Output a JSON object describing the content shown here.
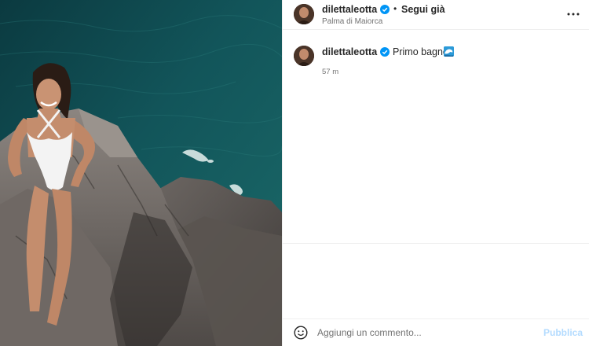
{
  "post": {
    "author": {
      "username": "dilettaleotta",
      "verified": true,
      "follow_status": "Segui già",
      "location": "Palma di Maiorca"
    },
    "caption": {
      "username": "dilettaleotta",
      "text": "Primo bagno",
      "emoji_icon": "water-wave-icon",
      "time_ago": "57 m"
    },
    "comment_box": {
      "placeholder": "Aggiungi un commento...",
      "value": "",
      "publish_label": "Pubblica"
    }
  },
  "icons": {
    "more": "more-options-icon",
    "verified": "verified-badge-icon",
    "emoji": "emoji-icon"
  },
  "colors": {
    "verified_blue": "#0095f6",
    "publish_disabled": "#b3dbff",
    "secondary_text": "#737373",
    "primary_text": "#262626",
    "sea_dark": "#0b3b40",
    "sea_teal": "#1d6a6c"
  }
}
